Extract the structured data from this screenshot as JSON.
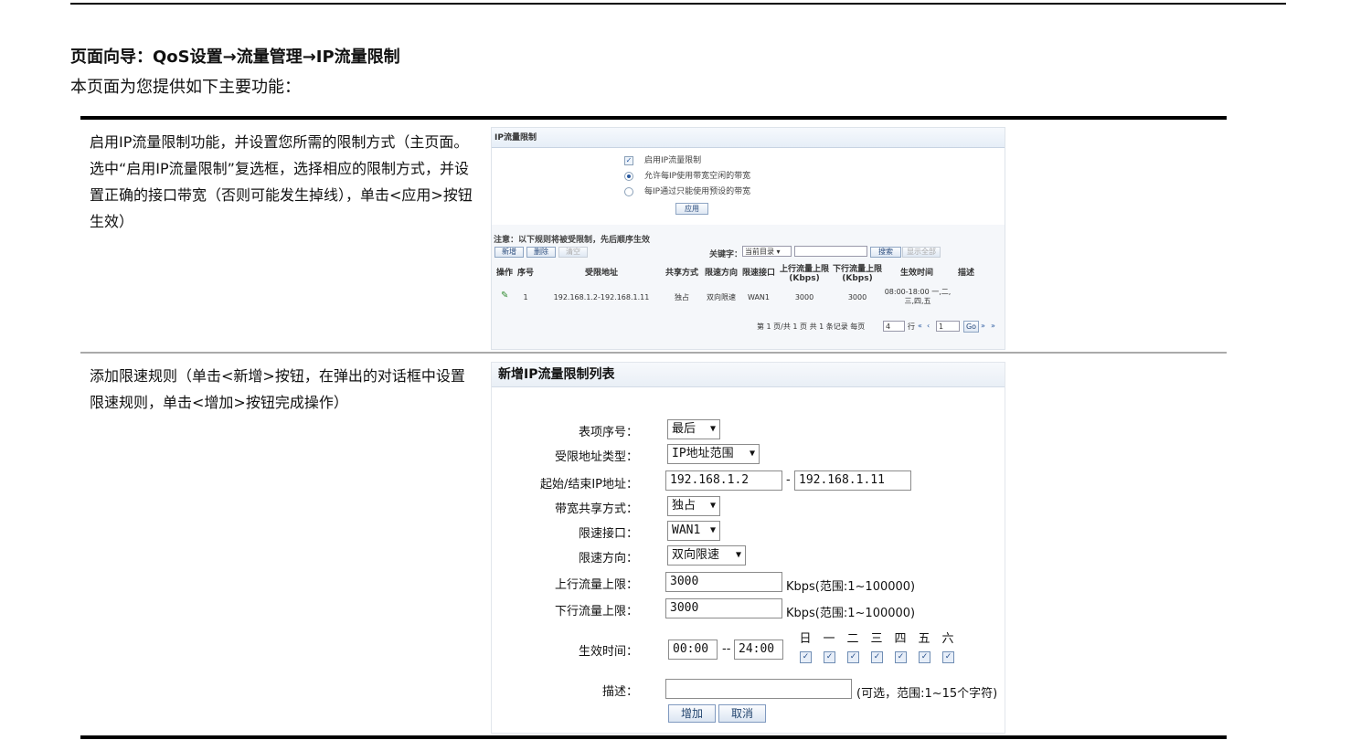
{
  "doc": {
    "nav_title": "页面向导：QoS设置→流量管理→IP流量限制",
    "intro": "本页面为您提供如下主要功能：",
    "rows": [
      {
        "description": "启用IP流量限制功能，并设置您所需的限制方式（主页面。选中“启用IP流量限制”复选框，选择相应的限制方式，并设置正确的接口带宽（否则可能发生掉线），单击<应用>按钮生效）"
      },
      {
        "description": "添加限速规则（单击<新增>按钮，在弹出的对话框中设置限速规则，单击<增加>按钮完成操作）"
      }
    ]
  },
  "shot1": {
    "header": "IP流量限制",
    "options": {
      "enable": "启用IP流量限制",
      "mode1": "允许每IP使用带宽空闲的带宽",
      "mode2": "每IP通过只能使用预设的带宽"
    },
    "apply": "应用",
    "note": "注意：以下规则将被受限制，先后顺序生效",
    "toolbar": {
      "add": "新增",
      "del": "删除",
      "clear": "清空",
      "keyword_label": "关键字：",
      "keyword_select": "当前目录",
      "search": "搜索",
      "show_all": "显示全部"
    },
    "columns": [
      "操作",
      "序号",
      "受限地址",
      "共享方式",
      "限速方向",
      "限速接口",
      "上行流量上限(Kbps)",
      "下行流量上限(Kbps)",
      "生效时间",
      "描述"
    ],
    "row": {
      "index": "1",
      "address": "192.168.1.2-192.168.1.11",
      "share": "独占",
      "direction": "双向限速",
      "iface": "WAN1",
      "up": "3000",
      "down": "3000",
      "time": "08:00-18:00 一,二,三,四,五",
      "desc": ""
    },
    "pager": {
      "text": "第 1 页/共 1 页 共 1 条记录 每页",
      "per_page": "4",
      "rows_label": "行",
      "page": "1",
      "go": "Go"
    }
  },
  "shot2": {
    "title": "新增IP流量限制列表",
    "fields": {
      "entry_no": {
        "label": "表项序号：",
        "value": "最后"
      },
      "addr_type": {
        "label": "受限地址类型：",
        "value": "IP地址范围"
      },
      "ip_range": {
        "label": "起始/结束IP地址：",
        "start": "192.168.1.2",
        "end": "192.168.1.11"
      },
      "share": {
        "label": "带宽共享方式：",
        "value": "独占"
      },
      "iface": {
        "label": "限速接口：",
        "value": "WAN1"
      },
      "direction": {
        "label": "限速方向：",
        "value": "双向限速"
      },
      "up": {
        "label": "上行流量上限：",
        "value": "3000",
        "hint": "Kbps(范围:1~100000)"
      },
      "down": {
        "label": "下行流量上限：",
        "value": "3000",
        "hint": "Kbps(范围:1~100000)"
      },
      "time": {
        "label": "生效时间：",
        "start": "00:00",
        "end": "24:00"
      },
      "desc": {
        "label": "描述：",
        "value": "",
        "hint": "(可选，范围:1~15个字符)"
      }
    },
    "days": [
      "日",
      "一",
      "二",
      "三",
      "四",
      "五",
      "六"
    ],
    "buttons": {
      "add": "增加",
      "cancel": "取消"
    }
  }
}
